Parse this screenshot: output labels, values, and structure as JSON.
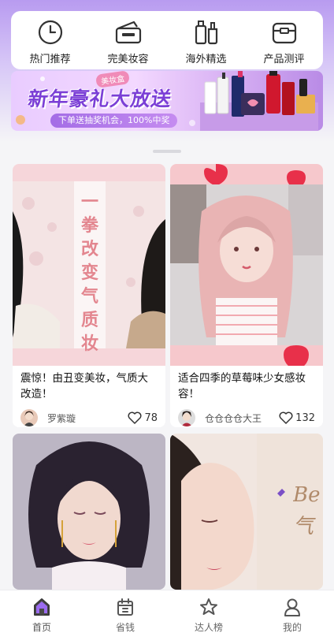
{
  "categories": [
    {
      "label": "热门推荐",
      "icon": "clock-icon"
    },
    {
      "label": "完美妆容",
      "icon": "makeup-case-icon"
    },
    {
      "label": "海外精选",
      "icon": "bottles-icon"
    },
    {
      "label": "产品测评",
      "icon": "box-icon"
    }
  ],
  "banner": {
    "tag": "美妆盒",
    "title": "新年豪礼大放送",
    "subtitle": "下单送抽奖机会，100%中奖"
  },
  "cards": [
    {
      "overlay_text": "一拳改变气质妆",
      "title": "震惊！由丑变美妆，气质大改造！",
      "author": "罗紫璇",
      "likes": "78"
    },
    {
      "title": "适合四季的草莓味少女感妆容！",
      "author": "仓仓仓仓大王",
      "likes": "132"
    },
    {
      "title": "",
      "author": "",
      "likes": ""
    },
    {
      "overlay_text": "Be 气",
      "title": "",
      "author": "",
      "likes": ""
    }
  ],
  "tabs": [
    {
      "label": "首页",
      "icon": "home-icon",
      "active": true
    },
    {
      "label": "省钱",
      "icon": "coupon-icon"
    },
    {
      "label": "达人榜",
      "icon": "star-icon"
    },
    {
      "label": "我的",
      "icon": "user-icon"
    }
  ],
  "colors": {
    "accent": "#7b3fd6",
    "banner_bg": "#e9ccff",
    "strawberry": "#e8304a"
  }
}
